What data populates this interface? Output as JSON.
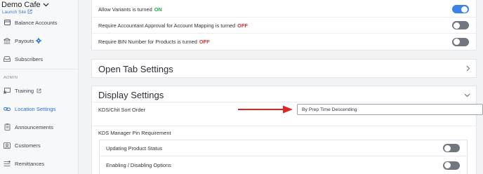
{
  "sidebar": {
    "brand": "Demo Cafe",
    "launch_link": "Launch Site",
    "section_admin": "ADMIN",
    "items": [
      {
        "label": "Balance Accounts",
        "icon": "bank-card-icon"
      },
      {
        "label": "Payouts",
        "icon": "bank-icon"
      },
      {
        "label": "Subscribers",
        "icon": "inbox-icon"
      },
      {
        "label": "Training",
        "icon": "training-icon"
      },
      {
        "label": "Location Settings",
        "icon": "link-icon"
      },
      {
        "label": "Announcements",
        "icon": "announcement-icon"
      },
      {
        "label": "Customers",
        "icon": "customers-icon"
      },
      {
        "label": "Remittances",
        "icon": "remittances-icon"
      }
    ]
  },
  "main": {
    "settings_rows": [
      {
        "prefix": "Allow Variants is turned ",
        "status": "ON",
        "toggle": "on"
      },
      {
        "prefix": "Require Accountant Approval for Account Mapping is turned ",
        "status": "OFF",
        "toggle": "off"
      },
      {
        "prefix": "Require BIN Number for Products is turned ",
        "status": "OFF",
        "toggle": "off"
      }
    ],
    "open_tab_title": "Open Tab Settings",
    "display_title": "Display Settings",
    "kds_sort_label": "KDS/Chit Sort Order",
    "kds_sort_value": "By Prep Time Descending",
    "pin_requirement_label": "KDS Manager Pin Requirement",
    "pin_items": [
      {
        "label": "Updating Product Status",
        "toggle": "off"
      },
      {
        "label": "Enabling / Disabling Options",
        "toggle": "off"
      }
    ]
  },
  "colors": {
    "accent": "#3b82e6",
    "on": "#27a74a",
    "off": "#d93434",
    "arrow": "#e02424"
  }
}
